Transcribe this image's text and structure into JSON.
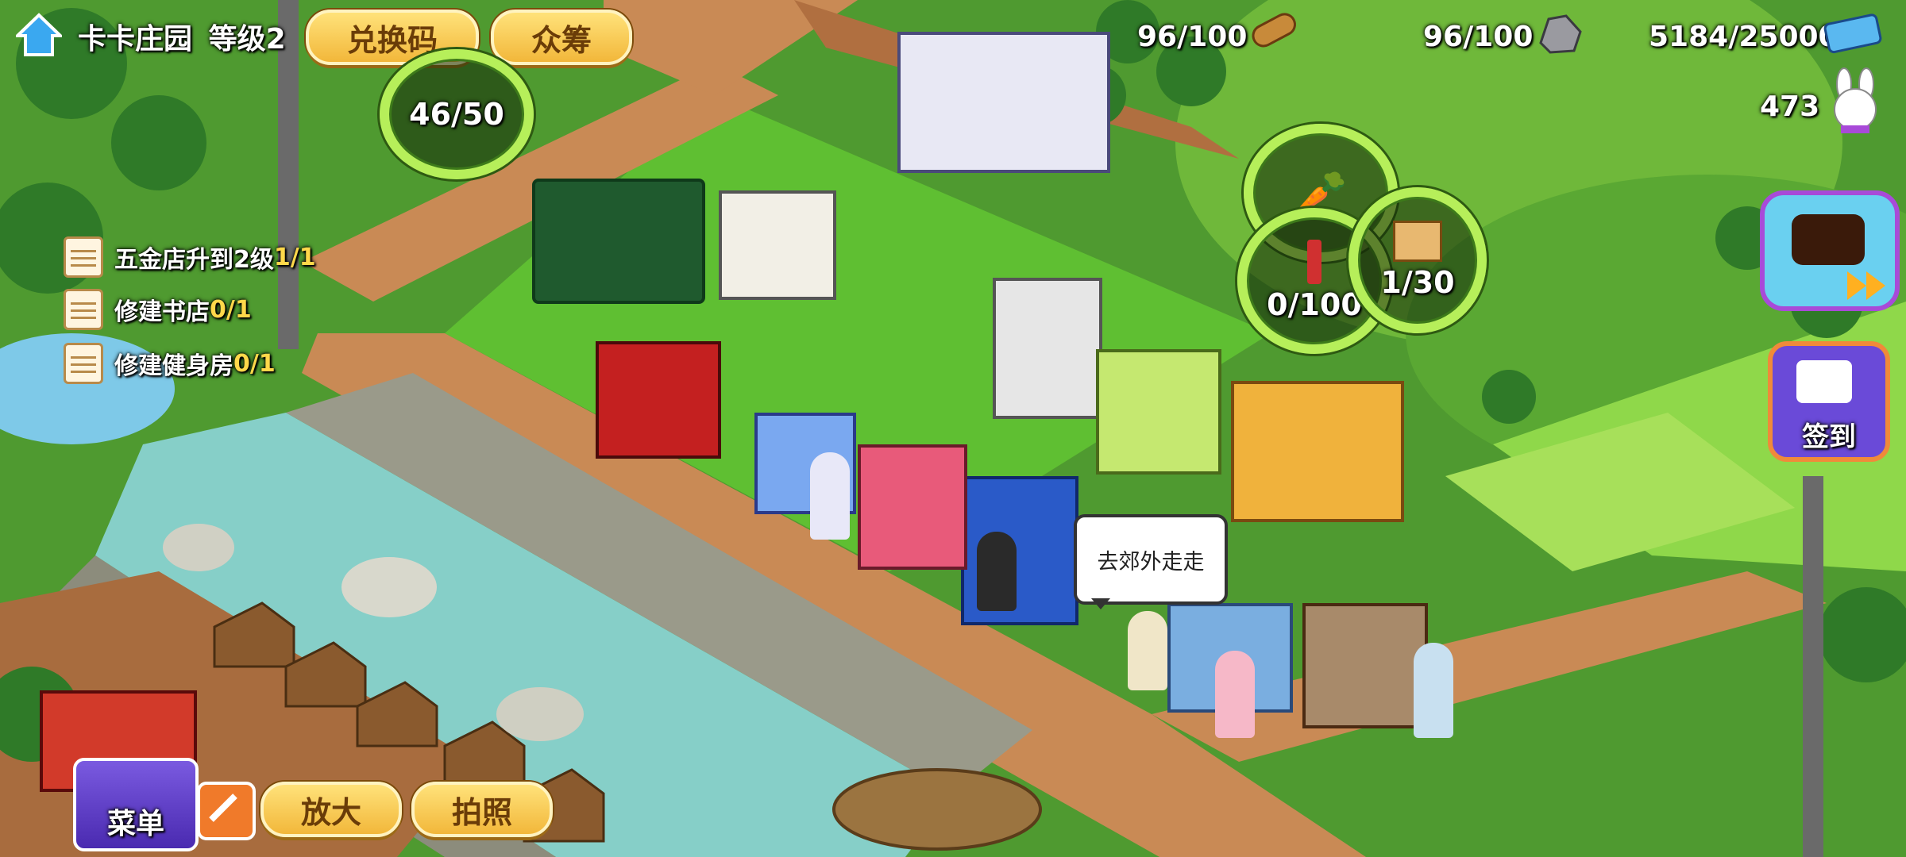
{
  "player": {
    "farm_name": "卡卡庄园",
    "level_label": "等级2"
  },
  "top_buttons": {
    "redeem": "兑换码",
    "crowdfund": "众筹"
  },
  "energy_ring": {
    "value": "46/50"
  },
  "resources": {
    "wood": "96/100",
    "stone": "96/100",
    "coins": "5184/25000",
    "tickets": "473"
  },
  "tasks": [
    {
      "title": "五金店升到2级",
      "progress": "1/1"
    },
    {
      "title": "修建书店",
      "progress": "0/1"
    },
    {
      "title": "修建健身房",
      "progress": "0/1"
    }
  ],
  "production_rings": {
    "tools": "0/100",
    "boxes": "1/30"
  },
  "checkin": {
    "label": "签到"
  },
  "speech_bubble": {
    "text": "去郊外走走"
  },
  "bottom_buttons": {
    "menu": "菜单",
    "zoom": "放大",
    "photo": "拍照"
  },
  "colors": {
    "grass": "#5fae3a",
    "dirt": "#b8774a",
    "river": "#7fc9c4",
    "button_gold": "#f2b73a",
    "ring_green": "#b6ef5a"
  }
}
